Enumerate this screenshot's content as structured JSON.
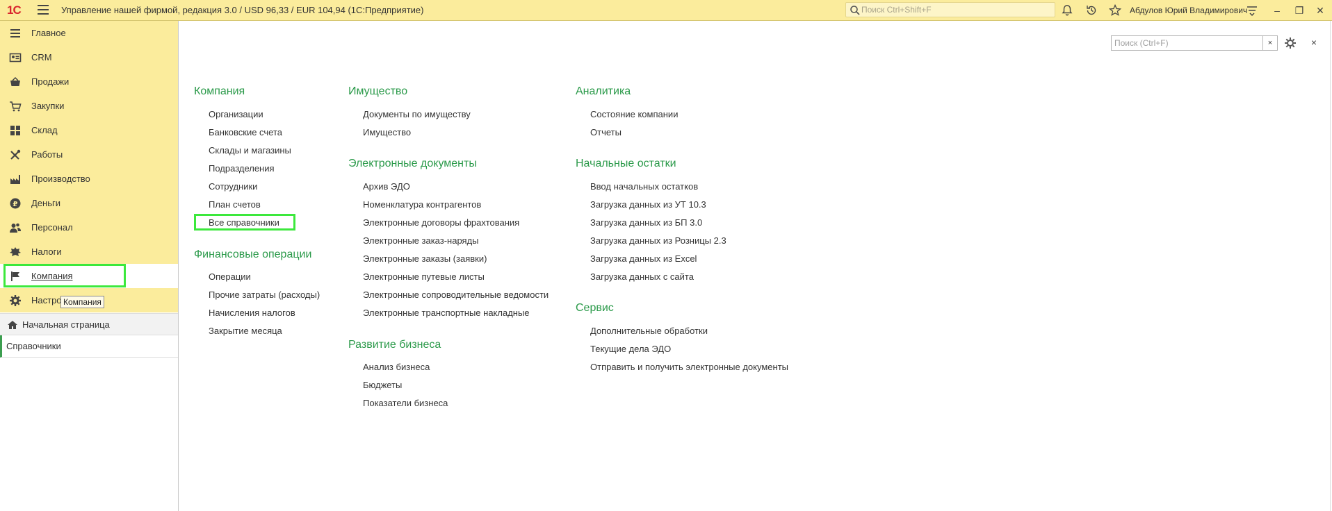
{
  "app": {
    "logo": "1С",
    "title": "Управление нашей фирмой, редакция 3.0 / USD 96,33 / EUR 104,94  (1С:Предприятие)",
    "search_placeholder": "Поиск Ctrl+Shift+F",
    "user": "Абдулов Юрий Владимирович"
  },
  "sidebar": {
    "sections": [
      {
        "label": "Главное",
        "icon": "menu-lines-icon"
      },
      {
        "label": "CRM",
        "icon": "contact-card-icon"
      },
      {
        "label": "Продажи",
        "icon": "basket-icon"
      },
      {
        "label": "Закупки",
        "icon": "cart-icon"
      },
      {
        "label": "Склад",
        "icon": "warehouse-grid-icon"
      },
      {
        "label": "Работы",
        "icon": "tools-icon"
      },
      {
        "label": "Производство",
        "icon": "factory-icon"
      },
      {
        "label": "Деньги",
        "icon": "ruble-coin-icon"
      },
      {
        "label": "Персонал",
        "icon": "people-icon"
      },
      {
        "label": "Налоги",
        "icon": "emblem-icon"
      },
      {
        "label": "Компания",
        "icon": "flag-icon"
      },
      {
        "label": "Настро",
        "icon": "gear-icon"
      }
    ],
    "tooltip": "Компания",
    "home_label": "Начальная страница",
    "open_page_label": "Справочники"
  },
  "panel": {
    "search_placeholder": "Поиск (Ctrl+F)",
    "clear_label": "×",
    "close_label": "×"
  },
  "groups": [
    {
      "title": "Компания",
      "links": [
        "Организации",
        "Банковские счета",
        "Склады и магазины",
        "Подразделения",
        "Сотрудники",
        "План счетов",
        "Все справочники"
      ]
    },
    {
      "title": "Финансовые операции",
      "links": [
        "Операции",
        "Прочие затраты (расходы)",
        "Начисления налогов",
        "Закрытие месяца"
      ]
    },
    {
      "title": "Имущество",
      "links": [
        "Документы по имуществу",
        "Имущество"
      ]
    },
    {
      "title": "Электронные документы",
      "links": [
        "Архив ЭДО",
        "Номенклатура контрагентов",
        "Электронные договоры фрахтования",
        "Электронные заказ-наряды",
        "Электронные заказы (заявки)",
        "Электронные путевые листы",
        "Электронные сопроводительные ведомости",
        "Электронные транспортные накладные"
      ]
    },
    {
      "title": "Развитие бизнеса",
      "links": [
        "Анализ бизнеса",
        "Бюджеты",
        "Показатели бизнеса"
      ]
    },
    {
      "title": "Аналитика",
      "links": [
        "Состояние компании",
        "Отчеты"
      ]
    },
    {
      "title": "Начальные остатки",
      "links": [
        "Ввод начальных остатков",
        "Загрузка данных из УТ 10.3",
        "Загрузка данных из БП 3.0",
        "Загрузка данных из Розницы 2.3",
        "Загрузка данных из Excel",
        "Загрузка данных с сайта"
      ]
    },
    {
      "title": "Сервис",
      "links": [
        "Дополнительные обработки",
        "Текущие дела ЭДО",
        "Отправить и получить электронные документы"
      ]
    }
  ]
}
